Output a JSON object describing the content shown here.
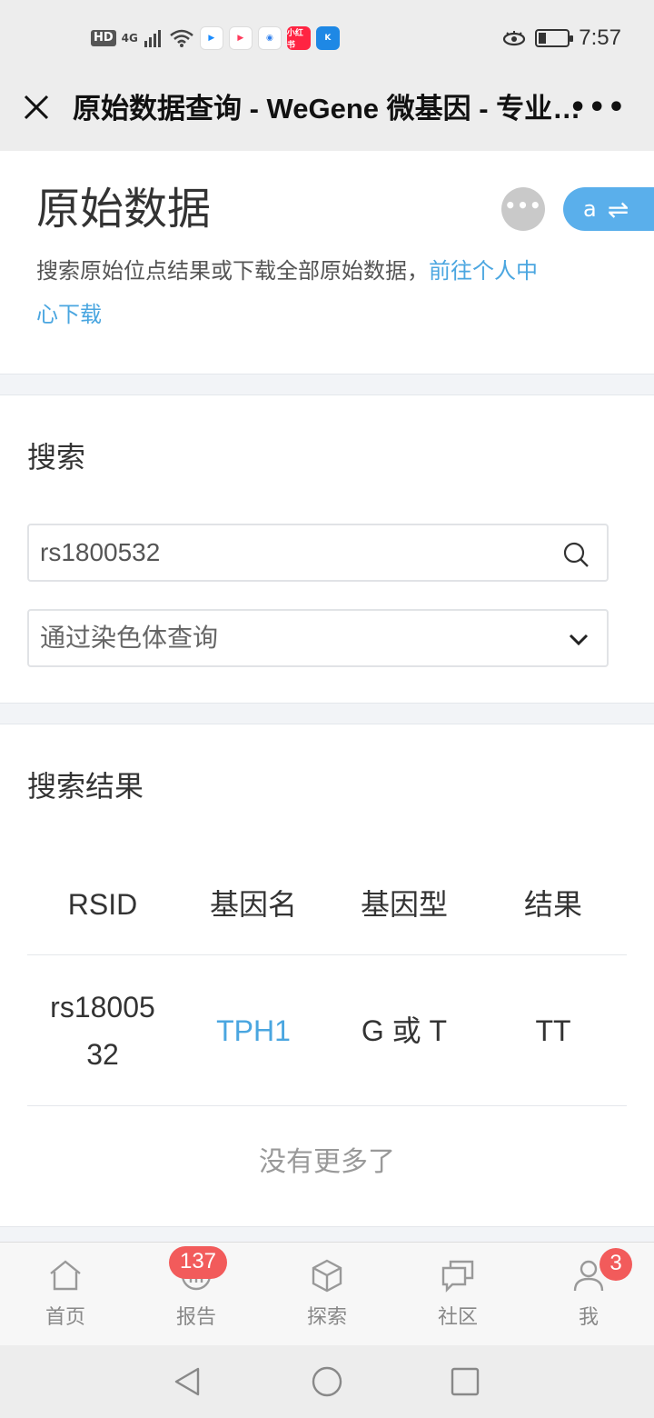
{
  "status_bar": {
    "hd": "HD",
    "network": "4G",
    "apps": [
      {
        "icon": "youku-icon",
        "color": "#1a8cff",
        "label": "YOUKU"
      },
      {
        "icon": "video-play-icon",
        "color": "#ff3b5c",
        "label": ""
      },
      {
        "icon": "browser-icon",
        "color": "#2f80ed",
        "label": ""
      },
      {
        "icon": "xiaohongshu-icon",
        "color": "#ff2442",
        "label": "小红书"
      },
      {
        "icon": "k-app-icon",
        "color": "#1e88e5",
        "label": "K"
      }
    ],
    "time": "7:57"
  },
  "nav": {
    "title": "原始数据查询 - WeGene 微基因 - 专业的基因检测服务",
    "more": "•••"
  },
  "header": {
    "title": "原始数据",
    "dots": "•••",
    "lang_label": "a",
    "lang_arrows": "⇌",
    "desc_text": "搜索原始位点结果或下载全部原始数据，",
    "desc_link": "前往个人中心下载"
  },
  "search": {
    "title": "搜索",
    "input_value": "rs1800532",
    "select_value": "通过染色体查询"
  },
  "results": {
    "title": "搜索结果",
    "columns": [
      "RSID",
      "基因名",
      "基因型",
      "结果"
    ],
    "rows": [
      {
        "rsid": "rs1800532",
        "gene": "TPH1",
        "genotype": "G 或 T",
        "result": "TT"
      }
    ],
    "no_more": "没有更多了"
  },
  "tabs": [
    {
      "label": "首页",
      "icon": "home-icon",
      "badge": ""
    },
    {
      "label": "报告",
      "icon": "report-icon",
      "badge": "137"
    },
    {
      "label": "探索",
      "icon": "cube-icon",
      "badge": ""
    },
    {
      "label": "社区",
      "icon": "chat-icon",
      "badge": ""
    },
    {
      "label": "我",
      "icon": "user-icon",
      "badge": "3"
    }
  ],
  "colors": {
    "accent": "#4aa6e0",
    "badge": "#f25b5b",
    "lang_button": "#5aafeb"
  }
}
